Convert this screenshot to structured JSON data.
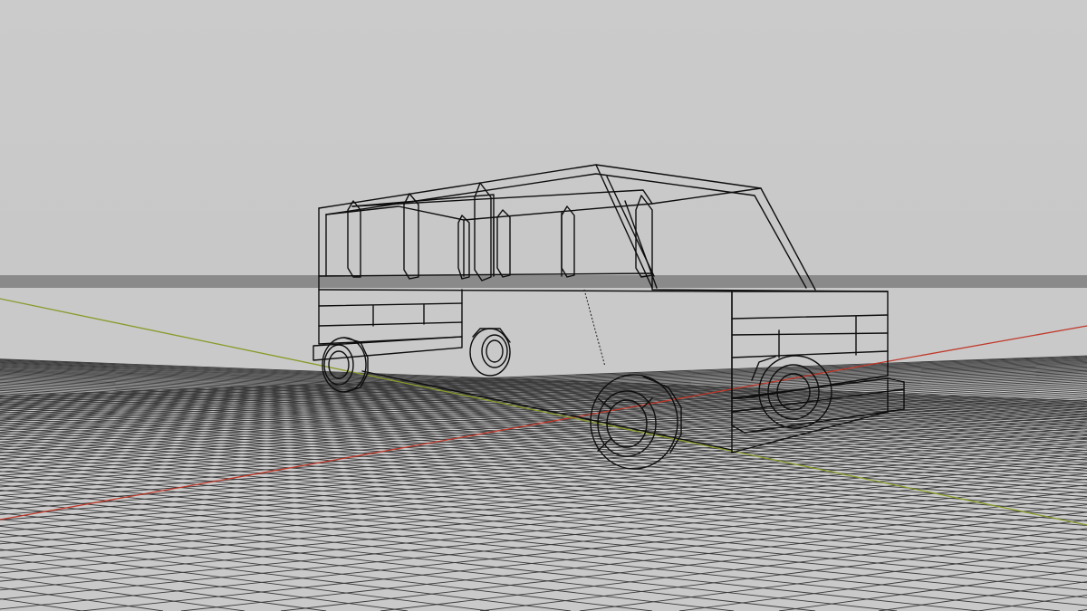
{
  "viewport": {
    "title": "",
    "background_color": "#c7c7c7",
    "grid_color": "#3a3a3a",
    "wire_color": "#0d0d0d",
    "x_axis_color": "#c0392b",
    "y_axis_color": "#8a9a2a"
  },
  "scene": {
    "object": "van-wireframe",
    "ground_grid": true,
    "axes_visible": true
  }
}
